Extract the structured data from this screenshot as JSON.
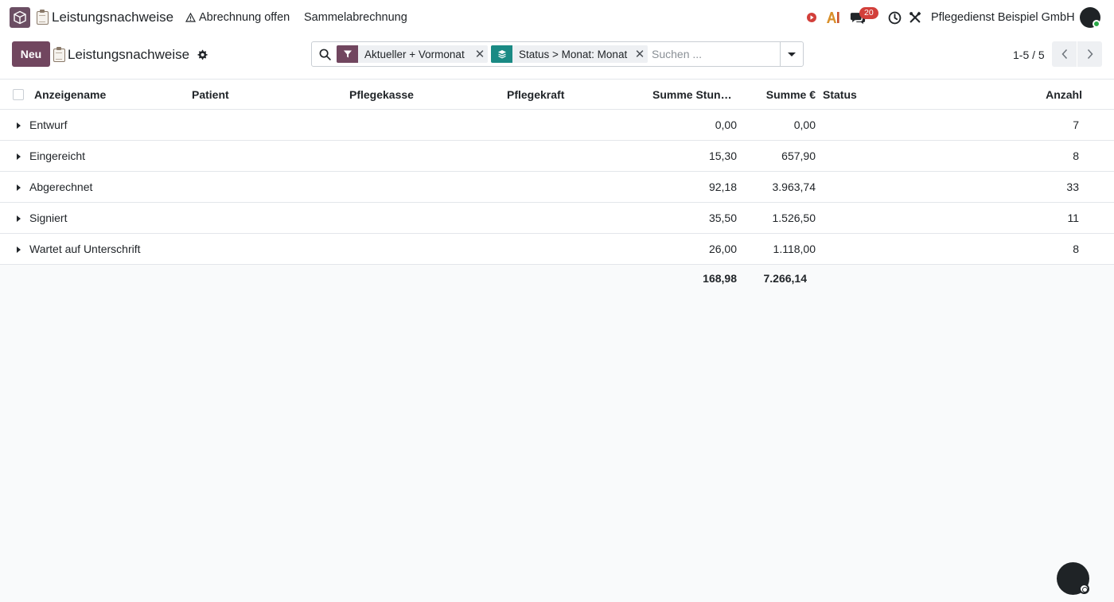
{
  "navbar": {
    "app_title": "Leistungsnachweise",
    "menu_items": [
      "Abrechnung offen",
      "Sammelabrechnung"
    ],
    "message_count": "20",
    "company": "Pflegedienst Beispiel GmbH",
    "icons": [
      "app-logo-icon",
      "clipboard-icon",
      "warning-icon",
      "record-icon",
      "ai-icon",
      "chat-icon",
      "clock-icon",
      "tools-icon",
      "avatar"
    ]
  },
  "control_panel": {
    "new_button": "Neu",
    "breadcrumb": "Leistungsnachweise",
    "search": {
      "facets": [
        {
          "label": "Aktueller + Vormonat",
          "icon": "filter-icon",
          "color": "#71465f"
        },
        {
          "label": "Status > Monat: Monat",
          "icon": "layers-icon",
          "color": "#1a8a84"
        }
      ],
      "placeholder": "Suchen ..."
    },
    "pager": "1-5 / 5"
  },
  "list": {
    "columns": [
      "Anzeigename",
      "Patient",
      "Pflegekasse",
      "Pflegekraft",
      "Summe Stunden",
      "Summe €",
      "Status",
      "Anzahl"
    ],
    "groups": [
      {
        "name": "Entwurf",
        "summe_stunden": "0,00",
        "summe_euro": "0,00",
        "anzahl": "7"
      },
      {
        "name": "Eingereicht",
        "summe_stunden": "15,30",
        "summe_euro": "657,90",
        "anzahl": "8"
      },
      {
        "name": "Abgerechnet",
        "summe_stunden": "92,18",
        "summe_euro": "3.963,74",
        "anzahl": "33"
      },
      {
        "name": "Signiert",
        "summe_stunden": "35,50",
        "summe_euro": "1.526,50",
        "anzahl": "11"
      },
      {
        "name": "Wartet auf Unterschrift",
        "summe_stunden": "26,00",
        "summe_euro": "1.118,00",
        "anzahl": "8"
      }
    ],
    "totals": {
      "summe_stunden": "168,98",
      "summe_euro": "7.266,14"
    }
  },
  "colors": {
    "primary": "#71465f",
    "teal": "#1a8a84",
    "badge": "#d23f3a"
  }
}
